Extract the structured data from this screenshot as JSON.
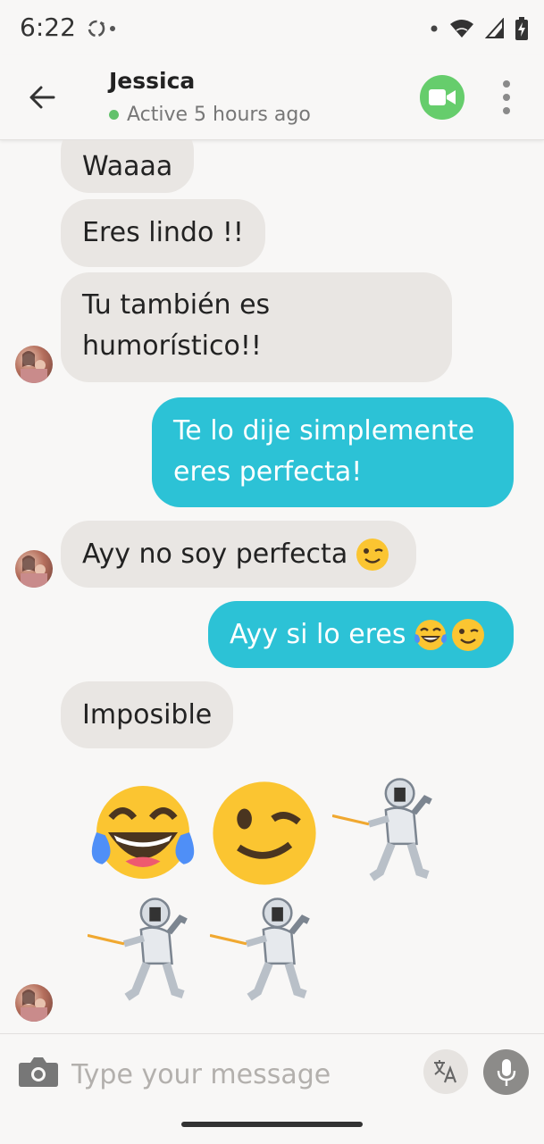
{
  "status_bar": {
    "time": "6:22"
  },
  "header": {
    "contact_name": "Jessica",
    "status": "Active 5 hours ago",
    "online_color": "#62c16c",
    "video_button_color": "#66cd6c"
  },
  "messages": [
    {
      "direction": "incoming",
      "text": "Waaaa"
    },
    {
      "direction": "incoming",
      "text": "Eres lindo !!"
    },
    {
      "direction": "incoming",
      "line1": "Tu también es",
      "line2": "humorístico!!",
      "text": "Tu también es humorístico!!"
    },
    {
      "direction": "outgoing",
      "line1": "Te lo dije simplemente",
      "line2": "eres perfecta!",
      "text": "Te lo dije simplemente eres perfecta!"
    },
    {
      "direction": "incoming",
      "text": "Ayy no soy perfecta",
      "emoji": [
        "winking-face"
      ]
    },
    {
      "direction": "outgoing",
      "text": "Ayy si lo eres",
      "emoji": [
        "tears-of-joy",
        "winking-face"
      ]
    },
    {
      "direction": "incoming",
      "text": "Imposible"
    },
    {
      "direction": "incoming",
      "type": "emoji-only",
      "emoji": [
        "tears-of-joy",
        "winking-face",
        "person-fencing",
        "person-fencing",
        "person-fencing"
      ]
    }
  ],
  "composer": {
    "placeholder": "Type your message",
    "icons": [
      "camera-icon",
      "translate-icon",
      "microphone-icon"
    ]
  },
  "colors": {
    "incoming_bubble": "#e9e6e3",
    "outgoing_bubble": "#2cc2d6"
  }
}
